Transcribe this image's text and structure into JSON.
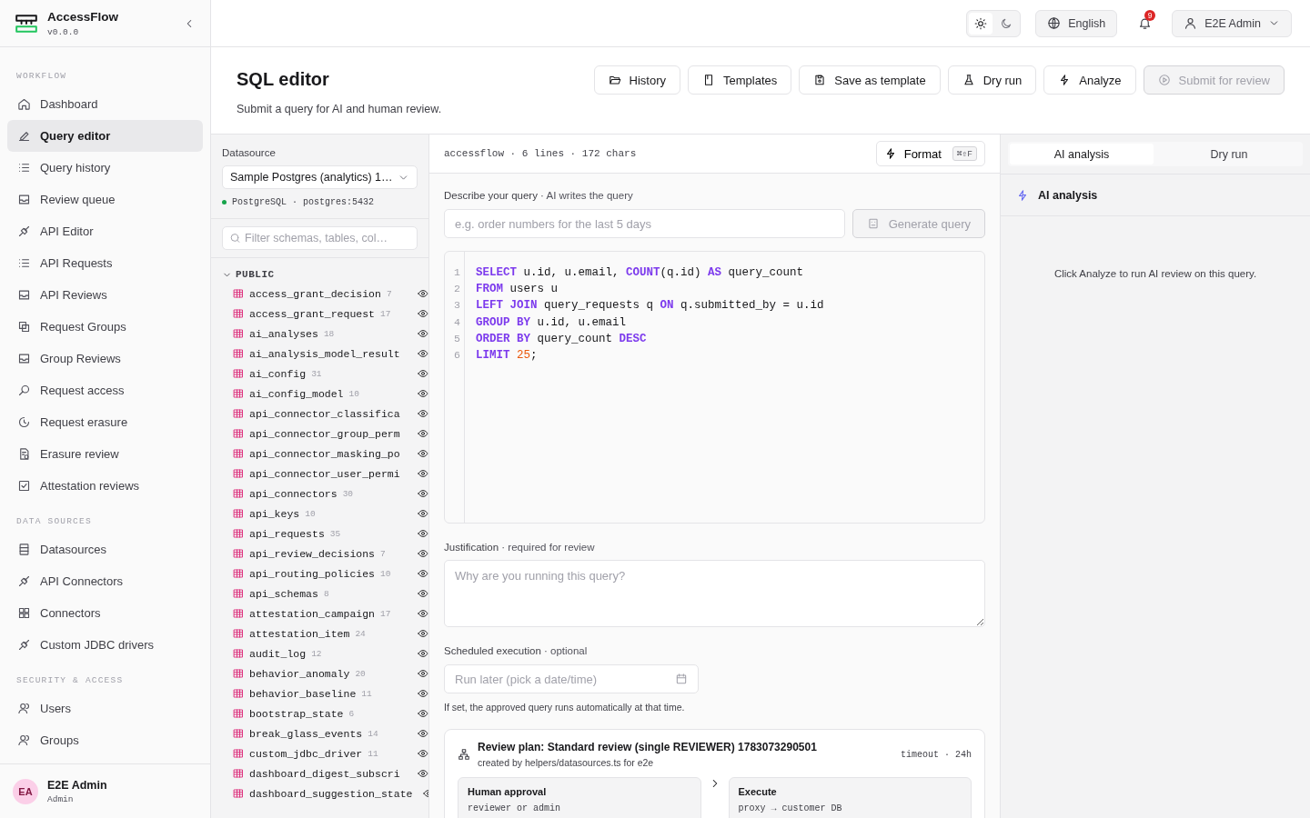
{
  "app": {
    "name": "AccessFlow",
    "version": "v0.0.0"
  },
  "sidebar": {
    "sections": [
      {
        "title": "WORKFLOW",
        "items": [
          {
            "label": "Dashboard",
            "selected": false
          },
          {
            "label": "Query editor",
            "selected": true
          },
          {
            "label": "Query history",
            "selected": false
          },
          {
            "label": "Review queue",
            "selected": false
          },
          {
            "label": "API Editor",
            "selected": false
          },
          {
            "label": "API Requests",
            "selected": false
          },
          {
            "label": "API Reviews",
            "selected": false
          },
          {
            "label": "Request Groups",
            "selected": false
          },
          {
            "label": "Group Reviews",
            "selected": false
          },
          {
            "label": "Request access",
            "selected": false
          },
          {
            "label": "Request erasure",
            "selected": false
          },
          {
            "label": "Erasure review",
            "selected": false
          },
          {
            "label": "Attestation reviews",
            "selected": false
          }
        ]
      },
      {
        "title": "DATA SOURCES",
        "items": [
          {
            "label": "Datasources",
            "selected": false
          },
          {
            "label": "API Connectors",
            "selected": false
          },
          {
            "label": "Connectors",
            "selected": false
          },
          {
            "label": "Custom JDBC drivers",
            "selected": false
          }
        ]
      },
      {
        "title": "SECURITY & ACCESS",
        "items": [
          {
            "label": "Users",
            "selected": false
          },
          {
            "label": "Groups",
            "selected": false
          }
        ]
      }
    ],
    "user": {
      "initials": "EA",
      "name": "E2E Admin",
      "role": "Admin"
    }
  },
  "topbar": {
    "theme": [
      {
        "selected": true
      },
      {
        "selected": false
      }
    ],
    "language": "English",
    "notifications": "9",
    "account": "E2E Admin"
  },
  "page": {
    "title": "SQL editor",
    "subtitle": "Submit a query for AI and human review.",
    "actions": [
      {
        "label": "History",
        "disabled": false
      },
      {
        "label": "Templates",
        "disabled": false
      },
      {
        "label": "Save as template",
        "disabled": false
      },
      {
        "label": "Dry run",
        "disabled": false
      },
      {
        "label": "Analyze",
        "disabled": false
      },
      {
        "label": "Submit for review",
        "disabled": true
      }
    ]
  },
  "schema_panel": {
    "datasource_label": "Datasource",
    "datasource_value": "Sample Postgres (analytics) 1…",
    "connection": "PostgreSQL · postgres:5432",
    "filter_placeholder": "Filter schemas, tables, col…",
    "schema": {
      "name": "PUBLIC",
      "expanded": true,
      "tables": [
        {
          "name": "access_grant_decision",
          "count": "7"
        },
        {
          "name": "access_grant_request",
          "count": "17"
        },
        {
          "name": "ai_analyses",
          "count": "18"
        },
        {
          "name": "ai_analysis_model_result"
        },
        {
          "name": "ai_config",
          "count": "31"
        },
        {
          "name": "ai_config_model",
          "count": "10"
        },
        {
          "name": "api_connector_classifica"
        },
        {
          "name": "api_connector_group_perm"
        },
        {
          "name": "api_connector_masking_po"
        },
        {
          "name": "api_connector_user_permi"
        },
        {
          "name": "api_connectors",
          "count": "30"
        },
        {
          "name": "api_keys",
          "count": "10"
        },
        {
          "name": "api_requests",
          "count": "35"
        },
        {
          "name": "api_review_decisions",
          "count": "7"
        },
        {
          "name": "api_routing_policies",
          "count": "10"
        },
        {
          "name": "api_schemas",
          "count": "8"
        },
        {
          "name": "attestation_campaign",
          "count": "17"
        },
        {
          "name": "attestation_item",
          "count": "24"
        },
        {
          "name": "audit_log",
          "count": "12"
        },
        {
          "name": "behavior_anomaly",
          "count": "20"
        },
        {
          "name": "behavior_baseline",
          "count": "11"
        },
        {
          "name": "bootstrap_state",
          "count": "6"
        },
        {
          "name": "break_glass_events",
          "count": "14"
        },
        {
          "name": "custom_jdbc_driver",
          "count": "11"
        },
        {
          "name": "dashboard_digest_subscri"
        },
        {
          "name": "dashboard_suggestion_state"
        }
      ]
    }
  },
  "editor": {
    "meta": "accessflow · 6 lines · 172 chars",
    "format_label": "Format",
    "format_shortcut": "⌘⇧F",
    "prompt_label": "**Describe your query** · AI writes the query",
    "prompt_placeholder": "e.g. order numbers for the last 5 days",
    "generate_label": "Generate query",
    "generate_disabled": true,
    "code": [
      {
        "number": "1",
        "tokens": [
          {
            "kind": "keyword",
            "text": "SELECT"
          },
          {
            "kind": "plain",
            "text": " u.id, u.email, "
          },
          {
            "kind": "keyword",
            "text": "COUNT"
          },
          {
            "kind": "plain",
            "text": "(q.id) "
          },
          {
            "kind": "keyword",
            "text": "AS"
          },
          {
            "kind": "plain",
            "text": " query_count"
          }
        ]
      },
      {
        "number": "2",
        "tokens": [
          {
            "kind": "keyword",
            "text": "FROM"
          },
          {
            "kind": "plain",
            "text": " users u"
          }
        ]
      },
      {
        "number": "3",
        "tokens": [
          {
            "kind": "keyword",
            "text": "LEFT JOIN"
          },
          {
            "kind": "plain",
            "text": " query_requests q "
          },
          {
            "kind": "keyword",
            "text": "ON"
          },
          {
            "kind": "plain",
            "text": " q.submitted_by = u.id"
          }
        ]
      },
      {
        "number": "4",
        "tokens": [
          {
            "kind": "keyword",
            "text": "GROUP BY"
          },
          {
            "kind": "plain",
            "text": " u.id, u.email"
          }
        ]
      },
      {
        "number": "5",
        "tokens": [
          {
            "kind": "keyword",
            "text": "ORDER BY"
          },
          {
            "kind": "plain",
            "text": " query_count "
          },
          {
            "kind": "keyword",
            "text": "DESC"
          }
        ]
      },
      {
        "number": "6",
        "tokens": [
          {
            "kind": "keyword",
            "text": "LIMIT "
          },
          {
            "kind": "number",
            "text": "25"
          },
          {
            "kind": "plain",
            "text": ";"
          }
        ]
      }
    ],
    "justification_label": "**Justification** · required for review",
    "justification_placeholder": "Why are you running this query?",
    "schedule_label": "**Scheduled execution** · optional",
    "schedule_placeholder": "Run later (pick a date/time)",
    "schedule_help": "If set, the approved query runs automatically at that time.",
    "review_plan": {
      "title": "Review plan: Standard review (single REVIEWER) 1783073290501",
      "subtitle": "created by helpers/datasources.ts for e2e",
      "timeout": "timeout · 24h",
      "steps": [
        {
          "title": "Human approval",
          "detail": "reviewer or admin"
        },
        {
          "title": "Execute",
          "detail": "proxy → customer DB"
        }
      ]
    }
  },
  "right_panel": {
    "tabs": [
      {
        "label": "AI analysis",
        "selected": true
      },
      {
        "label": "Dry run",
        "selected": false
      }
    ],
    "heading": "AI analysis",
    "empty_message": "Click Analyze to run AI review on this query."
  }
}
